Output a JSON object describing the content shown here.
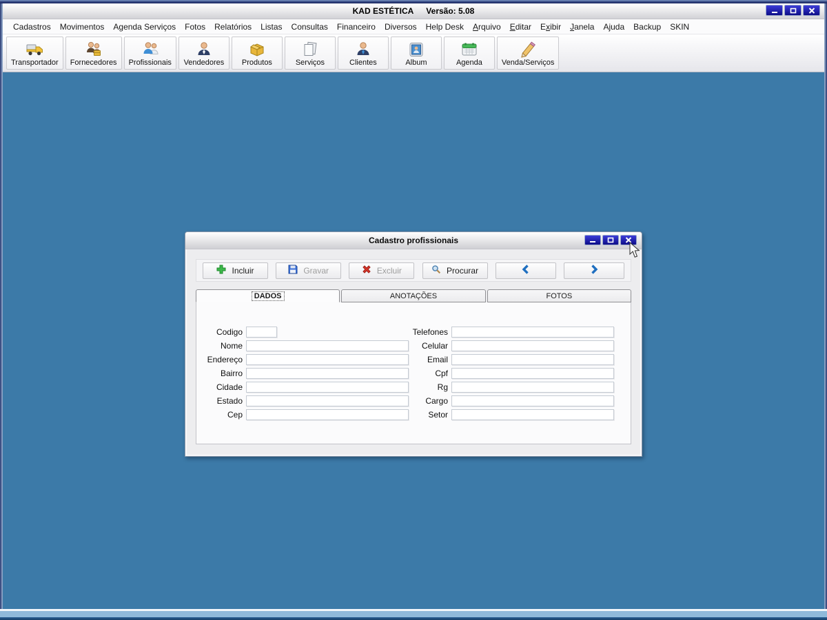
{
  "window": {
    "app_title": "KAD ESTÉTICA",
    "version": "Versão: 5.08"
  },
  "colors": {
    "desktop_blue": "#3c7aa8",
    "control_button_navy": "#0d0d88",
    "nav_chevron_blue": "#1f6fc0",
    "incluir_green": "#3db84a",
    "excluir_red": "#d8372a"
  },
  "menu": {
    "items": [
      {
        "pre": "Cadastros",
        "u": "",
        "rest": ""
      },
      {
        "pre": "Movimentos",
        "u": "",
        "rest": ""
      },
      {
        "pre": "Agenda Serviços",
        "u": "",
        "rest": ""
      },
      {
        "pre": "Fotos",
        "u": "",
        "rest": ""
      },
      {
        "pre": "Relatórios",
        "u": "",
        "rest": ""
      },
      {
        "pre": "Listas",
        "u": "",
        "rest": ""
      },
      {
        "pre": "Consultas",
        "u": "",
        "rest": ""
      },
      {
        "pre": "Financeiro",
        "u": "",
        "rest": ""
      },
      {
        "pre": "Diversos",
        "u": "",
        "rest": ""
      },
      {
        "pre": "Help Desk",
        "u": "",
        "rest": ""
      },
      {
        "pre": "",
        "u": "A",
        "rest": "rquivo"
      },
      {
        "pre": "",
        "u": "E",
        "rest": "ditar"
      },
      {
        "pre": "E",
        "u": "x",
        "rest": "ibir"
      },
      {
        "pre": "",
        "u": "J",
        "rest": "anela"
      },
      {
        "pre": "Ajuda",
        "u": "",
        "rest": ""
      },
      {
        "pre": "Backup",
        "u": "",
        "rest": ""
      },
      {
        "pre": "SKIN",
        "u": "",
        "rest": ""
      }
    ]
  },
  "toolbar": {
    "buttons": [
      {
        "label": "Transportador",
        "icon": "truck-icon"
      },
      {
        "label": "Fornecedores",
        "icon": "suppliers-icon"
      },
      {
        "label": "Profissionais",
        "icon": "professionals-icon"
      },
      {
        "label": "Vendedores",
        "icon": "seller-icon"
      },
      {
        "label": "Produtos",
        "icon": "products-icon"
      },
      {
        "label": "Serviços",
        "icon": "documents-icon"
      },
      {
        "label": "Clientes",
        "icon": "client-icon"
      },
      {
        "label": "Album",
        "icon": "album-icon"
      },
      {
        "label": "Agenda",
        "icon": "calendar-icon"
      },
      {
        "label": "Venda/Serviços",
        "icon": "pencil-icon"
      }
    ]
  },
  "dialog": {
    "title": "Cadastro profissionais",
    "toolbar": {
      "incluir": {
        "label": "Incluir",
        "enabled": true
      },
      "gravar": {
        "label": "Gravar",
        "enabled": false
      },
      "excluir": {
        "label": "Excluir",
        "enabled": false
      },
      "procurar": {
        "label": "Procurar",
        "enabled": true
      }
    },
    "tabs": [
      {
        "label": "DADOS",
        "active": true
      },
      {
        "label": "ANOTAÇÕES",
        "active": false
      },
      {
        "label": "FOTOS",
        "active": false
      }
    ],
    "fields_left": [
      {
        "label": "Codigo",
        "value": ""
      },
      {
        "label": "Nome",
        "value": ""
      },
      {
        "label": "Endereço",
        "value": ""
      },
      {
        "label": "Bairro",
        "value": ""
      },
      {
        "label": "Cidade",
        "value": ""
      },
      {
        "label": "Estado",
        "value": ""
      },
      {
        "label": "Cep",
        "value": ""
      }
    ],
    "fields_right": [
      {
        "label": "Telefones",
        "value": ""
      },
      {
        "label": "Celular",
        "value": ""
      },
      {
        "label": "Email",
        "value": ""
      },
      {
        "label": "Cpf",
        "value": ""
      },
      {
        "label": "Rg",
        "value": ""
      },
      {
        "label": "Cargo",
        "value": ""
      },
      {
        "label": "Setor",
        "value": ""
      }
    ]
  }
}
